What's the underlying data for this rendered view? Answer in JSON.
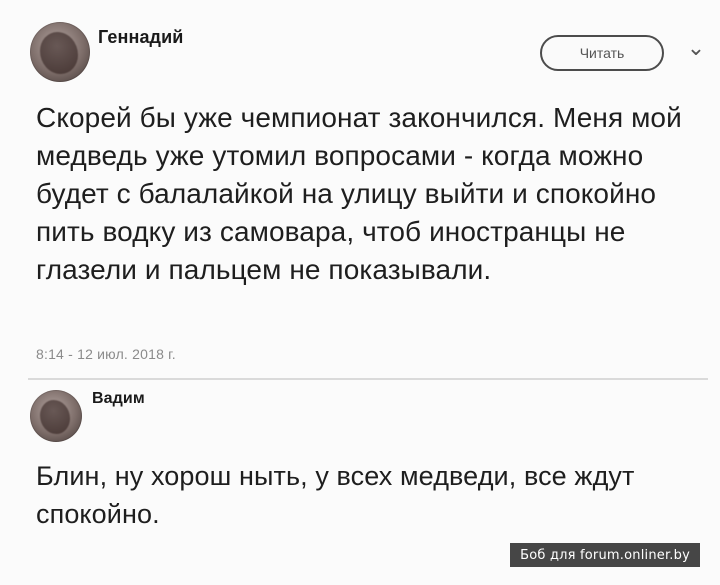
{
  "posts": [
    {
      "author": "Геннадий",
      "follow_label": "Читать",
      "text": "Скорей бы уже чемпионат закончился. Меня мой медведь уже утомил вопросами - когда можно будет с балалайкой на улицу выйти  и спокойно пить водку из самовара, чтоб иностранцы не глазели и пальцем не показывали.",
      "timestamp": "8:14 - 12 июл. 2018 г."
    },
    {
      "author": "Вадим",
      "text": "Блин, ну хорош ныть, у всех медведи, все ждут спокойно."
    }
  ],
  "watermark": "Боб для forum.onliner.by",
  "icons": {
    "menu": "chevron-down-icon"
  }
}
